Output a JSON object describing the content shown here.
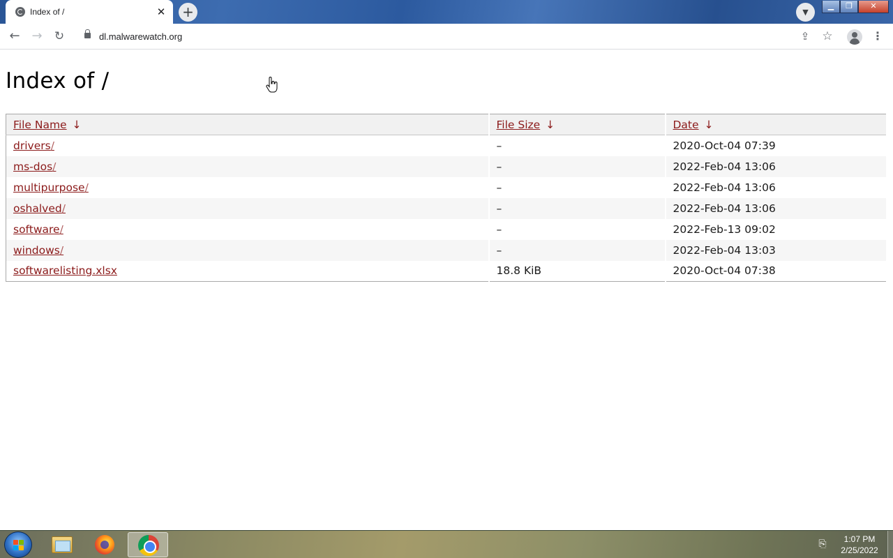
{
  "browser": {
    "tab_title": "Index of /",
    "tab_close": "✕",
    "new_tab": "+",
    "url": "dl.malwarewatch.org"
  },
  "page": {
    "heading": "Index of /",
    "columns": [
      {
        "label": "File Name",
        "sort_arrow": "↓"
      },
      {
        "label": "File Size",
        "sort_arrow": "↓"
      },
      {
        "label": "Date",
        "sort_arrow": "↓"
      }
    ],
    "rows": [
      {
        "name": "drivers",
        "suffix": "/",
        "size": "–",
        "date": "2020-Oct-04 07:39"
      },
      {
        "name": "ms-dos",
        "suffix": "/",
        "size": "–",
        "date": "2022-Feb-04 13:06"
      },
      {
        "name": "multipurpose",
        "suffix": "/",
        "size": "–",
        "date": "2022-Feb-04 13:06"
      },
      {
        "name": "oshalved",
        "suffix": "/",
        "size": "–",
        "date": "2022-Feb-04 13:06"
      },
      {
        "name": "software",
        "suffix": "/",
        "size": "–",
        "date": "2022-Feb-13 09:02"
      },
      {
        "name": "windows",
        "suffix": "/",
        "size": "–",
        "date": "2022-Feb-04 13:03"
      },
      {
        "name": "softwarelisting.xlsx",
        "suffix": "",
        "size": "18.8 KiB",
        "date": "2020-Oct-04 07:38"
      }
    ]
  },
  "taskbar": {
    "apps": [
      "windows-explorer",
      "firefox",
      "chrome"
    ],
    "time": "1:07 PM",
    "date": "2/25/2022"
  },
  "colors": {
    "link": "#8b1a1a",
    "header_bg": "#f1f1f1",
    "stripe_bg": "#f6f6f6"
  }
}
